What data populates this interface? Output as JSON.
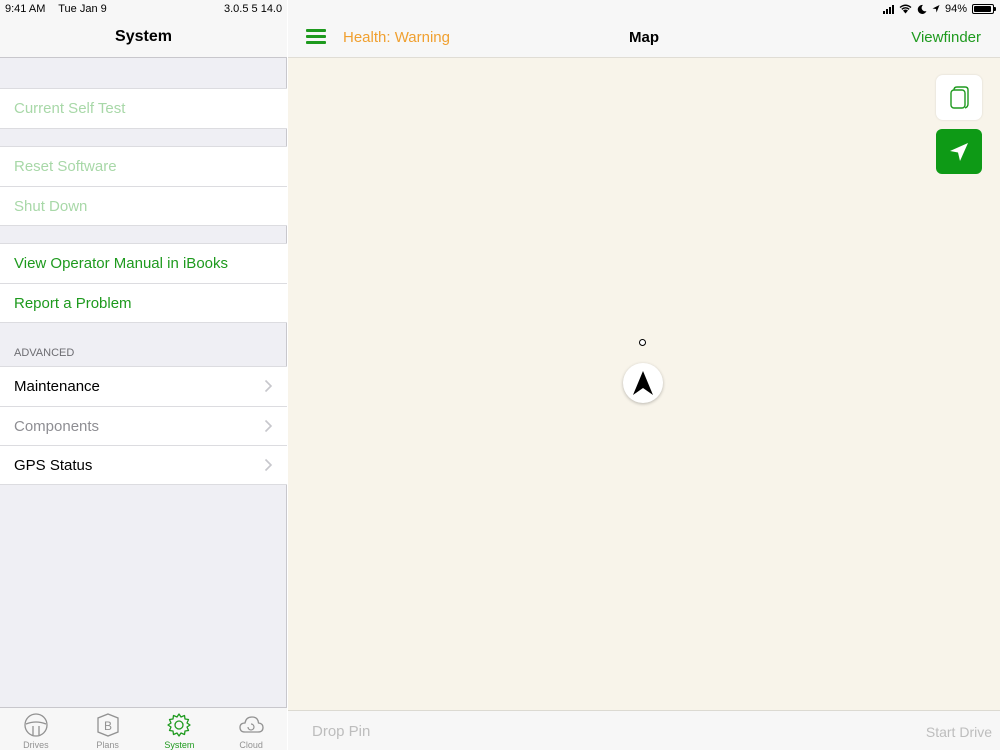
{
  "status_bar": {
    "time": "9:41 AM",
    "date": "Tue Jan 9",
    "version": "3.0.5 5 14.0",
    "battery": "94%"
  },
  "left_panel": {
    "title": "System",
    "groups": [
      {
        "items": [
          {
            "label": "Current Self Test"
          }
        ]
      },
      {
        "items": [
          {
            "label": "Reset Software"
          },
          {
            "label": "Shut Down"
          }
        ]
      },
      {
        "items": [
          {
            "label": "View Operator Manual in iBooks"
          },
          {
            "label": "Report a Problem"
          }
        ]
      }
    ],
    "advanced": {
      "header": "ADVANCED",
      "items": [
        {
          "label": "Maintenance"
        },
        {
          "label": "Components"
        },
        {
          "label": "GPS Status"
        }
      ]
    }
  },
  "tabbar": {
    "tabs": [
      {
        "label": "Drives",
        "icon": "steering-wheel-icon"
      },
      {
        "label": "Plans",
        "icon": "plans-b-icon"
      },
      {
        "label": "System",
        "icon": "gear-icon",
        "active": true
      },
      {
        "label": "Cloud",
        "icon": "cloud-icon"
      }
    ]
  },
  "map_panel": {
    "health": "Health: Warning",
    "title": "Map",
    "viewfinder": "Viewfinder",
    "drop_pin": "Drop Pin",
    "start_drive": "Start Drive"
  },
  "colors": {
    "accent_green": "#1e9a1e",
    "locate_green": "#0e9a16",
    "warning_orange": "#f0a030",
    "map_bg": "#f8f4ea"
  }
}
